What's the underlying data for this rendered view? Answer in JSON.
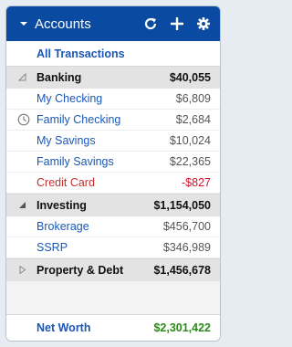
{
  "header": {
    "title": "Accounts",
    "icons": [
      "chevron-down-icon",
      "refresh-icon",
      "plus-icon",
      "gear-icon"
    ]
  },
  "all_transactions": "All Transactions",
  "groups": [
    {
      "name": "Banking",
      "amount": "$40,055",
      "expanded": true,
      "accounts": [
        {
          "name": "My Checking",
          "amount": "$6,809"
        },
        {
          "name": "Family Checking",
          "amount": "$2,684",
          "icon": "clock-icon"
        },
        {
          "name": "My Savings",
          "amount": "$10,024"
        },
        {
          "name": "Family Savings",
          "amount": "$22,365"
        },
        {
          "name": "Credit Card",
          "amount": "-$827",
          "negative": true
        }
      ]
    },
    {
      "name": "Investing",
      "amount": "$1,154,050",
      "expanded": true,
      "accounts": [
        {
          "name": "Brokerage",
          "amount": "$456,700"
        },
        {
          "name": "SSRP",
          "amount": "$346,989"
        }
      ]
    },
    {
      "name": "Property & Debt",
      "amount": "$1,456,678",
      "expanded": false,
      "accounts": []
    }
  ],
  "footer": {
    "label": "Net Worth",
    "amount": "$2,301,422"
  },
  "colors": {
    "header_bg": "#0a4aa0",
    "link": "#1a57b8",
    "negative": "#d0102a",
    "positive": "#2a8a1a"
  }
}
